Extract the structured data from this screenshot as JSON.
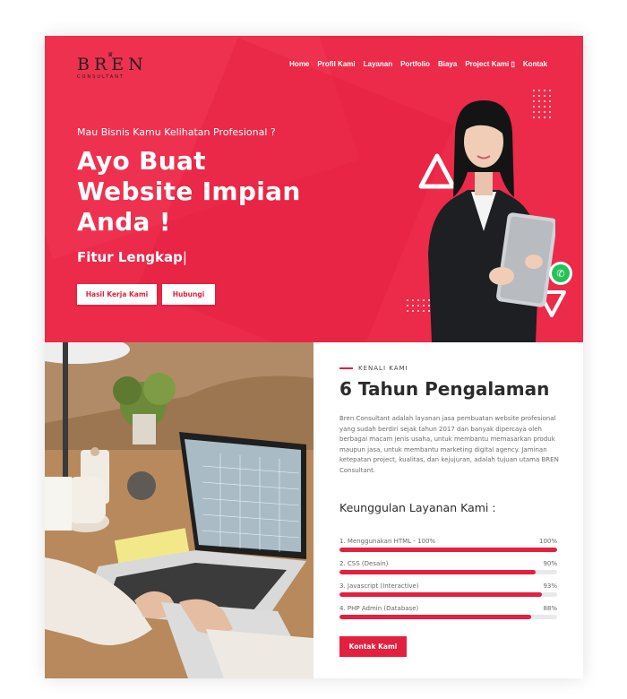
{
  "logo": {
    "word": "BREN",
    "sub": "CONSULTANT"
  },
  "nav": [
    "Home",
    "Profil Kami",
    "Layanan",
    "Portfolio",
    "Biaya",
    "Project Kami ▯",
    "Kontak"
  ],
  "hero": {
    "kicker": "Mau Bisnis Kamu Kelihatan Profesional ?",
    "title_line1": "Ayo Buat",
    "title_line2": "Website Impian",
    "title_line3": "Anda !",
    "typed": "Fitur Lengkap",
    "cursor": "|",
    "button1": "Hasil Kerja Kami",
    "button2": "Hubungi"
  },
  "about": {
    "eyebrow": "KENALI KAMI",
    "title": "6 Tahun Pengalaman",
    "body": "Bren Consultant adalah layanan jasa pembuatan website profesional yang sudah berdiri sejak tahun 2017 dan banyak dipercaya oleh berbagai macam jenis usaha, untuk membantu memasarkan produk maupun jasa, untuk membantu marketing digital agency. Jaminan ketepatan project, kualitas, dan kejujuran, adalah tujuan utama BREN Consultant.",
    "skills_title": "Keunggulan Layanan Kami :",
    "skills": [
      {
        "label": "1. Menggunakan HTML - 100%",
        "percent_label": "100%",
        "value": 1.0
      },
      {
        "label": "2. CSS (Desain)",
        "percent_label": "90%",
        "value": 0.9
      },
      {
        "label": "3. Javascript (Interactive)",
        "percent_label": "93%",
        "value": 0.93
      },
      {
        "label": "4. PHP Admin (Database)",
        "percent_label": "88%",
        "value": 0.88
      }
    ],
    "cta": "Kontak Kami"
  },
  "colors": {
    "brand": "#ec2a4a",
    "button_red": "#e3203f",
    "whatsapp": "#25c25a"
  },
  "icons": [
    "whatsapp-icon",
    "crown-icon"
  ]
}
